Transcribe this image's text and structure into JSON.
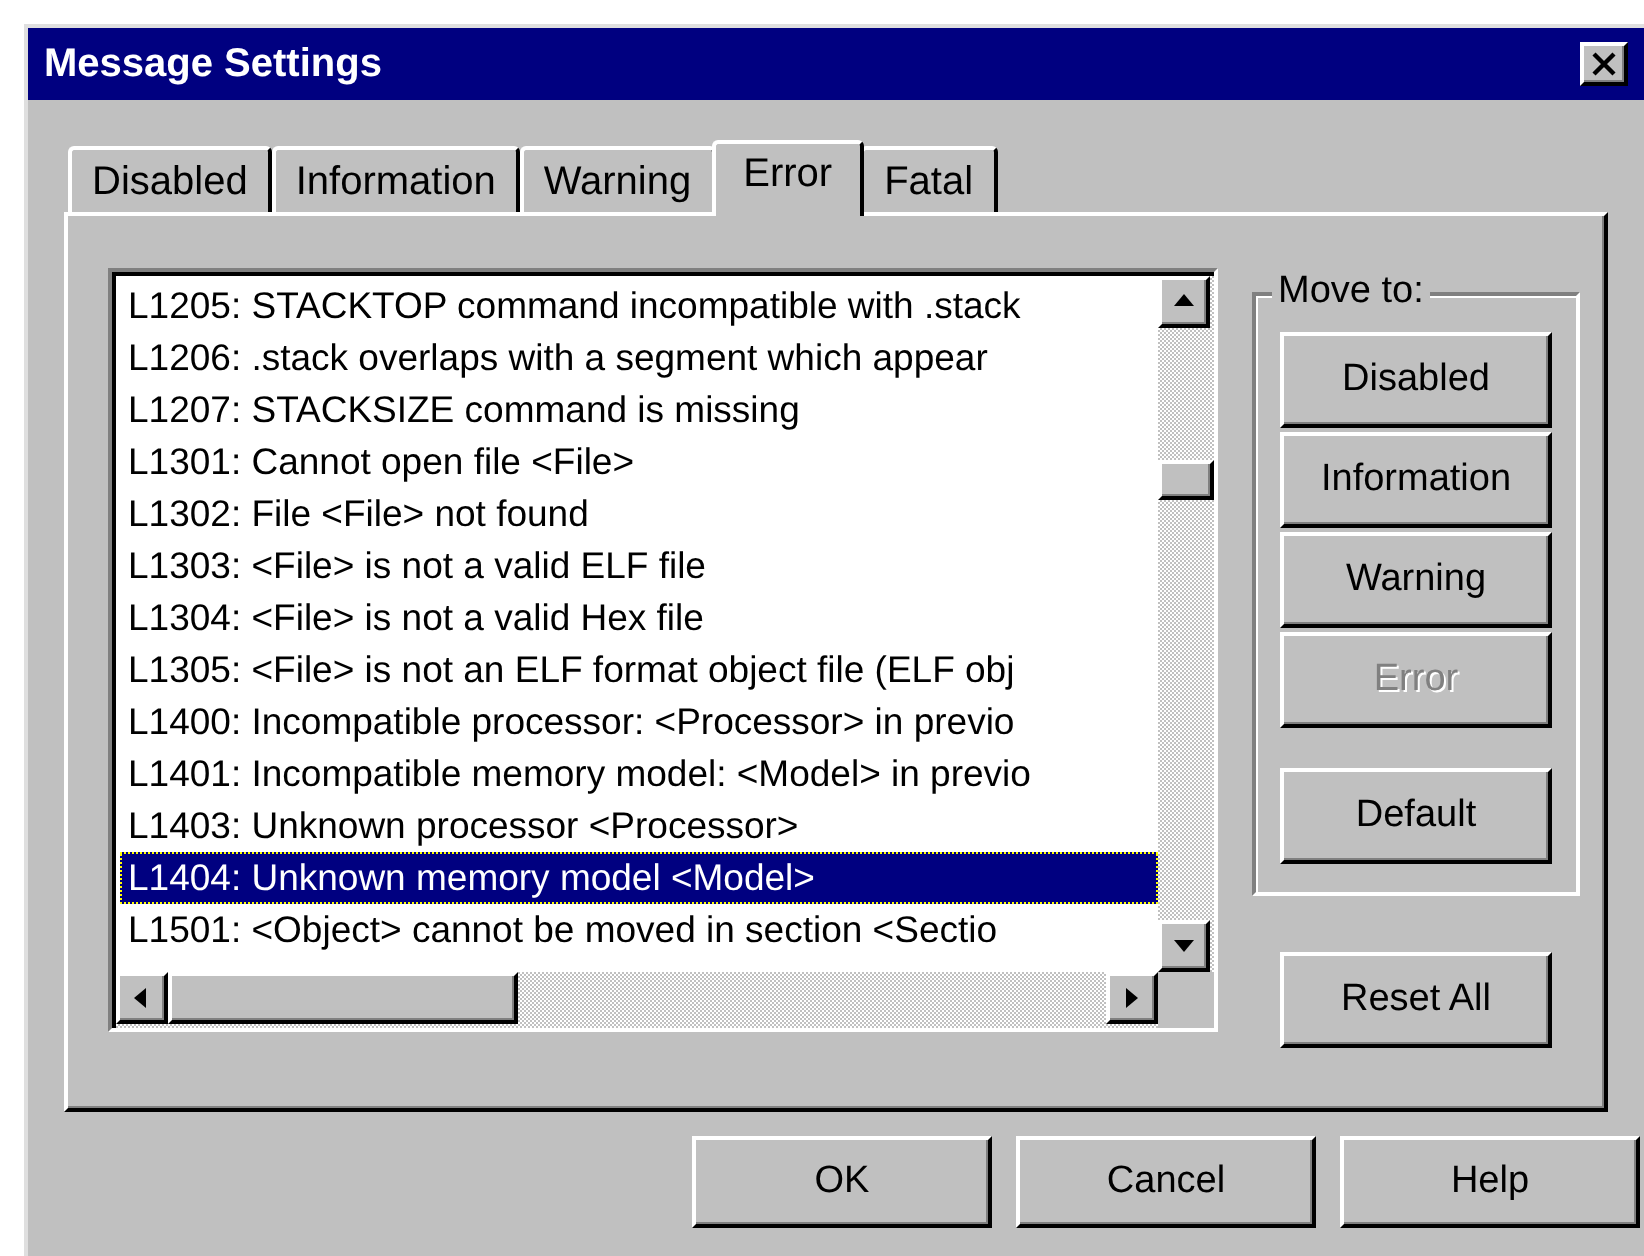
{
  "window": {
    "title": "Message Settings"
  },
  "tabs": [
    {
      "label": "Disabled",
      "selected": false
    },
    {
      "label": "Information",
      "selected": false
    },
    {
      "label": "Warning",
      "selected": false
    },
    {
      "label": "Error",
      "selected": true
    },
    {
      "label": "Fatal",
      "selected": false
    }
  ],
  "messages": [
    {
      "text": "L1205: STACKTOP command incompatible with .stack",
      "selected": false
    },
    {
      "text": "L1206: .stack overlaps with a segment which appear",
      "selected": false
    },
    {
      "text": "L1207: STACKSIZE command is missing",
      "selected": false
    },
    {
      "text": "L1301: Cannot open file <File>",
      "selected": false
    },
    {
      "text": "L1302: File <File> not found",
      "selected": false
    },
    {
      "text": "L1303: <File> is not a valid ELF file",
      "selected": false
    },
    {
      "text": "L1304: <File> is not a valid Hex file",
      "selected": false
    },
    {
      "text": "L1305: <File> is not an ELF format object file (ELF obj",
      "selected": false
    },
    {
      "text": "L1400: Incompatible processor: <Processor> in previo",
      "selected": false
    },
    {
      "text": "L1401: Incompatible memory model: <Model> in previo",
      "selected": false
    },
    {
      "text": "L1403: Unknown processor <Processor>",
      "selected": false
    },
    {
      "text": "L1404: Unknown memory model <Model>",
      "selected": true
    },
    {
      "text": "L1501: <Object> cannot be moved in section <Sectio",
      "selected": false
    }
  ],
  "move_to": {
    "label": "Move to:",
    "buttons": [
      {
        "label": "Disabled",
        "disabled": false
      },
      {
        "label": "Information",
        "disabled": false
      },
      {
        "label": "Warning",
        "disabled": false
      },
      {
        "label": "Error",
        "disabled": true
      }
    ],
    "default_button": "Default"
  },
  "reset_button": "Reset All",
  "footer_buttons": [
    "OK",
    "Cancel",
    "Help"
  ]
}
